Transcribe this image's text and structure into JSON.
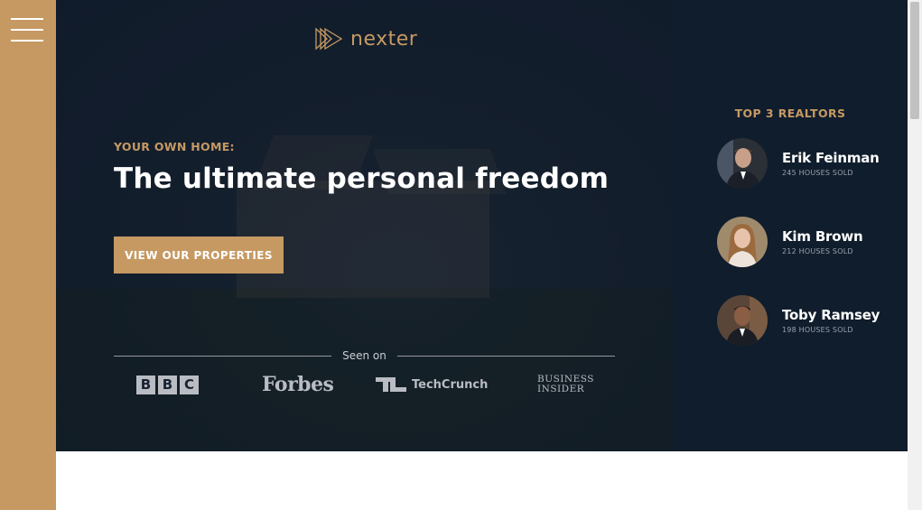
{
  "brand": {
    "name": "nexter",
    "accent": "#c69963",
    "dark": "#101d2c"
  },
  "menu": {
    "icon": "hamburger-menu-icon"
  },
  "hero": {
    "subtitle": "YOUR OWN HOME:",
    "title": "The ultimate personal freedom",
    "button_label": "VIEW OUR PROPERTIES",
    "seen_on_label": "Seen on",
    "press": {
      "bbc": [
        "B",
        "B",
        "C"
      ],
      "forbes": "Forbes",
      "techcrunch": "TechCrunch",
      "business_insider_line1": "BUSINESS",
      "business_insider_line2": "INSIDER"
    }
  },
  "realtors": {
    "title": "TOP 3 REALTORS",
    "items": [
      {
        "name": "Erik Feinman",
        "sold": "245 HOUSES SOLD"
      },
      {
        "name": "Kim Brown",
        "sold": "212 HOUSES SOLD"
      },
      {
        "name": "Toby Ramsey",
        "sold": "198 HOUSES SOLD"
      }
    ]
  }
}
